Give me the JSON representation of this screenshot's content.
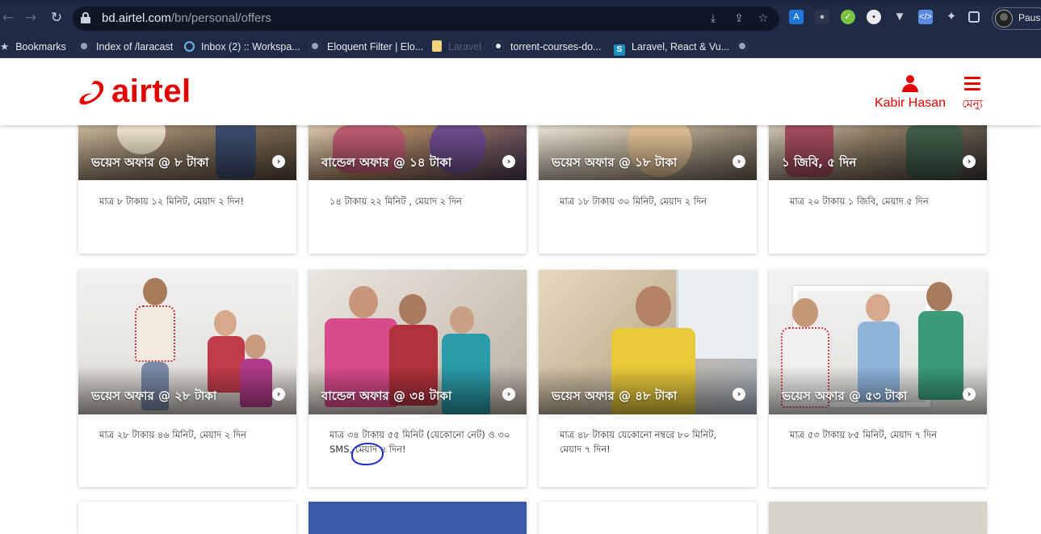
{
  "browser": {
    "url_host": "bd.airtel.com",
    "url_path": "/bn/personal/offers",
    "profile_label": "Pause",
    "bookmarks": [
      {
        "label": "Bookmarks",
        "icon": "star-icon"
      },
      {
        "label": "Index of /laracast",
        "icon": "globe-icon"
      },
      {
        "label": "Inbox (2) :: Workspa...",
        "icon": "mail-icon"
      },
      {
        "label": "Eloquent Filter | Elo...",
        "icon": "globe-icon"
      },
      {
        "label": "Laravel",
        "icon": "folder-icon"
      },
      {
        "label": "torrent-courses-do...",
        "icon": "github-icon"
      },
      {
        "label": "Laravel, React & Vu...",
        "icon": "s-logo-icon"
      },
      {
        "label": "",
        "icon": "globe-icon"
      }
    ]
  },
  "header": {
    "logo_text": "airtel",
    "user_name": "Kabir Hasan",
    "menu_label": "মেন্যু"
  },
  "offers_row1": [
    {
      "title": "ভয়েস অফার @ ৮ টাকা",
      "desc": "মাত্র ৮ টাকায় ১২ মিনিট, মেয়াদ ২ দিন!"
    },
    {
      "title": "বান্ডেল অফার @ ১৪ টাকা",
      "desc": "১৪ টাকায় ২২ মিনিট , মেয়াদ ২ দিন"
    },
    {
      "title": "ভয়েস অফার @ ১৮ টাকা",
      "desc": "মাত্র ১৮ টাকায় ৩০ মিনিট, মেয়াদ ২ দিন"
    },
    {
      "title": "১ জিবি, ৫ দিন",
      "desc": "মাত্র ২০ টাকায় ১ জিবি, মেয়াদ ৫ দিন"
    }
  ],
  "offers_row2": [
    {
      "title": "ভয়েস অফার @ ২৮ টাকা",
      "desc": "মাত্র ২৮ টাকায় ৪৬ মিনিট, মেয়াদ ২ দিন"
    },
    {
      "title": "বান্ডেল অফার @ ৩৪ টাকা",
      "desc": "মাত্র ৩৪ টাকায় ৫৫ মিনিট (যেকোনো নেট) ও ৩০ SMS, মেয়াদ ৪ দিন!"
    },
    {
      "title": "ভয়েস অফার @ ৪৮ টাকা",
      "desc": "মাত্র ৪৮ টাকায় যেকোনো নম্বরে ৮০ মিনিট, মেয়াদ ৭ দিন!"
    },
    {
      "title": "ভয়েস অফার @ ৫৩ টাকা",
      "desc": "মাত্র ৫৩ টাকায় ৮৫ মিনিট, মেয়াদ ৭ দিন"
    }
  ],
  "colors": {
    "brand_red": "#e40000",
    "chrome_bg": "#1f2b46",
    "annotation_blue": "#1c2bd6"
  }
}
